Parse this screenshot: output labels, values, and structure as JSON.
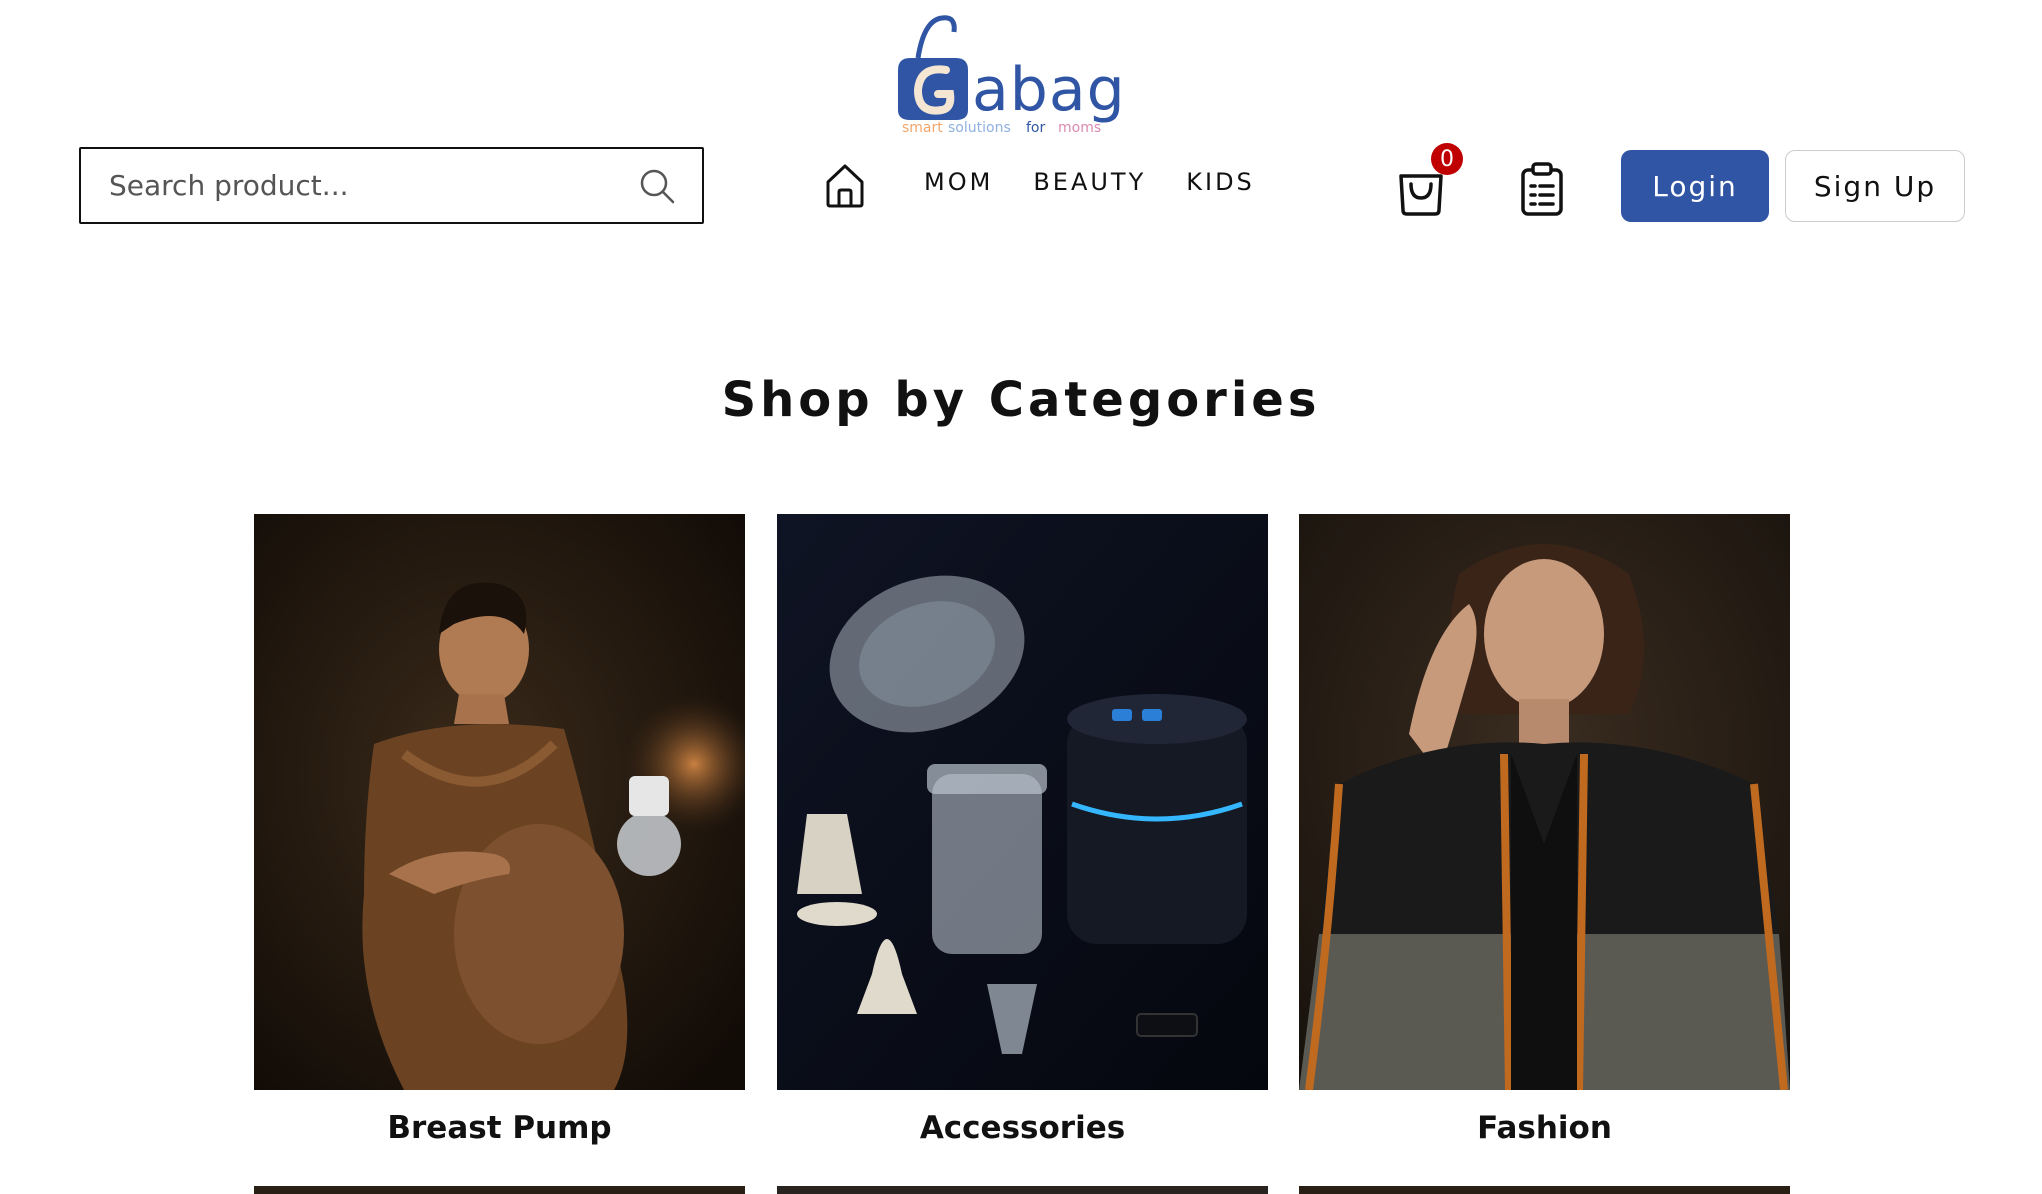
{
  "brand": {
    "logo_text": "Gabag",
    "tagline": "smart solutions for moms",
    "colors": {
      "primary": "#2f55a4",
      "accent": "#f2a56b",
      "badge": "#c00000"
    }
  },
  "header": {
    "search": {
      "placeholder": "Search product...",
      "value": "",
      "icon": "search-icon"
    },
    "home_icon": "home-icon",
    "nav": [
      {
        "label": "MOM"
      },
      {
        "label": "BEAUTY"
      },
      {
        "label": "KIDS"
      }
    ],
    "cart": {
      "icon": "cart-icon",
      "count": "0"
    },
    "orders": {
      "icon": "clipboard-icon"
    },
    "login_label": "Login",
    "signup_label": "Sign Up"
  },
  "main": {
    "section_title": "Shop by Categories",
    "categories": [
      {
        "label": "Breast Pump"
      },
      {
        "label": "Accessories"
      },
      {
        "label": "Fashion"
      }
    ]
  }
}
